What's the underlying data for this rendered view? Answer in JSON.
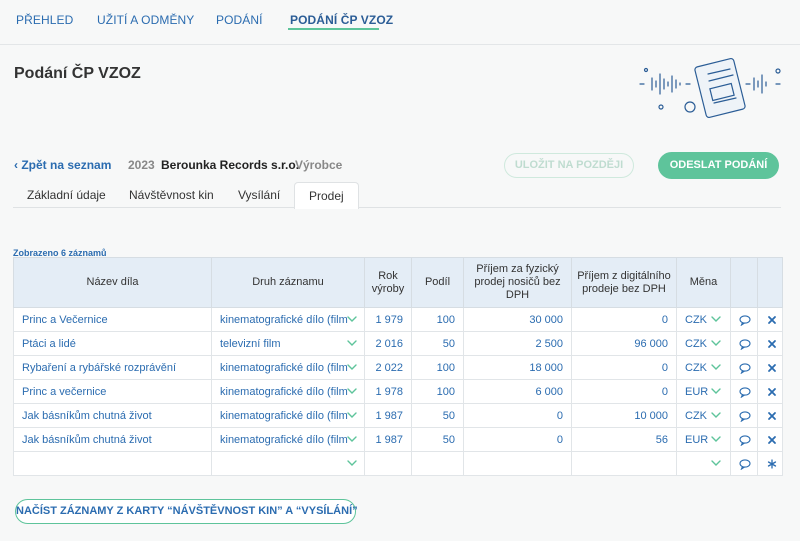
{
  "nav": {
    "items": [
      {
        "label": "PŘEHLED"
      },
      {
        "label": "UŽITÍ A ODMĚNY"
      },
      {
        "label": "PODÁNÍ"
      },
      {
        "label": "PODÁNÍ ČP VZOZ"
      }
    ],
    "active_index": 3
  },
  "page": {
    "title": "Podání ČP VZOZ",
    "back_label": "Zpět na seznam",
    "year": "2023",
    "company": "Berounka Records s.r.o.",
    "role": "Výrobce"
  },
  "actions": {
    "save_later": "ULOŽIT NA POZDĚJI",
    "send": "ODESLAT PODÁNÍ",
    "load_records": "NAČÍST ZÁZNAMY Z KARTY “NÁVŠTĚVNOST KIN” A “VYSÍLÁNÍ”"
  },
  "tabs": [
    "Základní údaje",
    "Návštěvnost kin",
    "Vysílání",
    "Prodej"
  ],
  "active_tab": 3,
  "table": {
    "count_label": "Zobrazeno 6 záznamů",
    "headers": {
      "title": "Název díla",
      "type": "Druh záznamu",
      "year": "Rok výroby",
      "share": "Podíl",
      "physical": "Příjem za fyzický prodej nosičů bez DPH",
      "digital": "Příjem z digitálního prodeje bez DPH",
      "currency": "Měna"
    },
    "rows": [
      {
        "title": "Princ a Večernice",
        "type": "kinematografické dílo (film)",
        "year": "1 979",
        "share": "100",
        "physical": "30 000",
        "digital": "0",
        "currency": "CZK"
      },
      {
        "title": "Ptáci a lidé",
        "type": "televizní film",
        "year": "2 016",
        "share": "50",
        "physical": "2 500",
        "digital": "96 000",
        "currency": "CZK"
      },
      {
        "title": "Rybaření a rybářské rozprávění",
        "type": "kinematografické dílo (film)",
        "year": "2 022",
        "share": "100",
        "physical": "18 000",
        "digital": "0",
        "currency": "CZK"
      },
      {
        "title": "Princ a večernice",
        "type": "kinematografické dílo (film)",
        "year": "1 978",
        "share": "100",
        "physical": "6 000",
        "digital": "0",
        "currency": "EUR"
      },
      {
        "title": "Jak básníkům chutná život",
        "type": "kinematografické dílo (film)",
        "year": "1 987",
        "share": "50",
        "physical": "0",
        "digital": "10 000",
        "currency": "CZK"
      },
      {
        "title": "Jak básníkům chutná život",
        "type": "kinematografické dílo (film)",
        "year": "1 987",
        "share": "50",
        "physical": "0",
        "digital": "56",
        "currency": "EUR"
      }
    ],
    "add_row_icon": "asterisk-icon"
  },
  "colors": {
    "link": "#2b6cb0",
    "accent": "#5ec49b",
    "header_bg": "#e4edf6"
  }
}
